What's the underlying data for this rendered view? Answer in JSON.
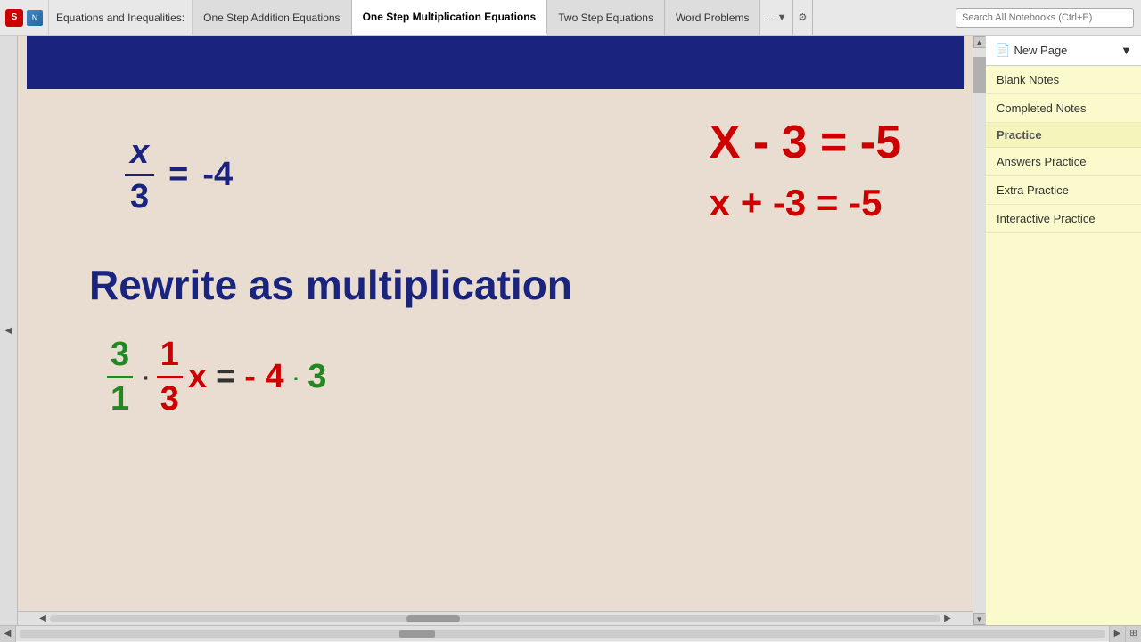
{
  "topbar": {
    "breadcrumb": "Equations and Inequalities:",
    "tabs": [
      {
        "label": "One Step Addition Equations",
        "active": false
      },
      {
        "label": "One Step Multiplication Equations",
        "active": true
      },
      {
        "label": "Two Step Equations",
        "active": false
      },
      {
        "label": "Word Problems",
        "active": false
      },
      {
        "label": "...",
        "active": false
      }
    ],
    "search_placeholder": "Search All Notebooks (Ctrl+E)"
  },
  "sidebar": {
    "new_page_label": "New Page",
    "items": [
      {
        "label": "Blank Notes",
        "type": "item"
      },
      {
        "label": "Completed Notes",
        "type": "item"
      },
      {
        "label": "Practice",
        "type": "category"
      },
      {
        "label": "Answers Practice",
        "type": "item"
      },
      {
        "label": "Extra Practice",
        "type": "item"
      },
      {
        "label": "Interactive Practice",
        "type": "item"
      }
    ]
  },
  "content": {
    "fraction_numerator": "x",
    "fraction_denominator": "3",
    "equals": "=",
    "neg_four": "-4",
    "red_eq1": "X - 3 = -5",
    "red_eq2": "x + -3 = -5",
    "rewrite_label": "Rewrite as multiplication",
    "mult_green_num": "3",
    "mult_green_den": "1",
    "mult_dot1": "·",
    "mult_red_num": "1",
    "mult_red_den": "3",
    "mult_red_x": "x",
    "mult_eq": "=",
    "mult_neg": "- 4",
    "mult_dot2": "·",
    "mult_green_three": "3"
  }
}
